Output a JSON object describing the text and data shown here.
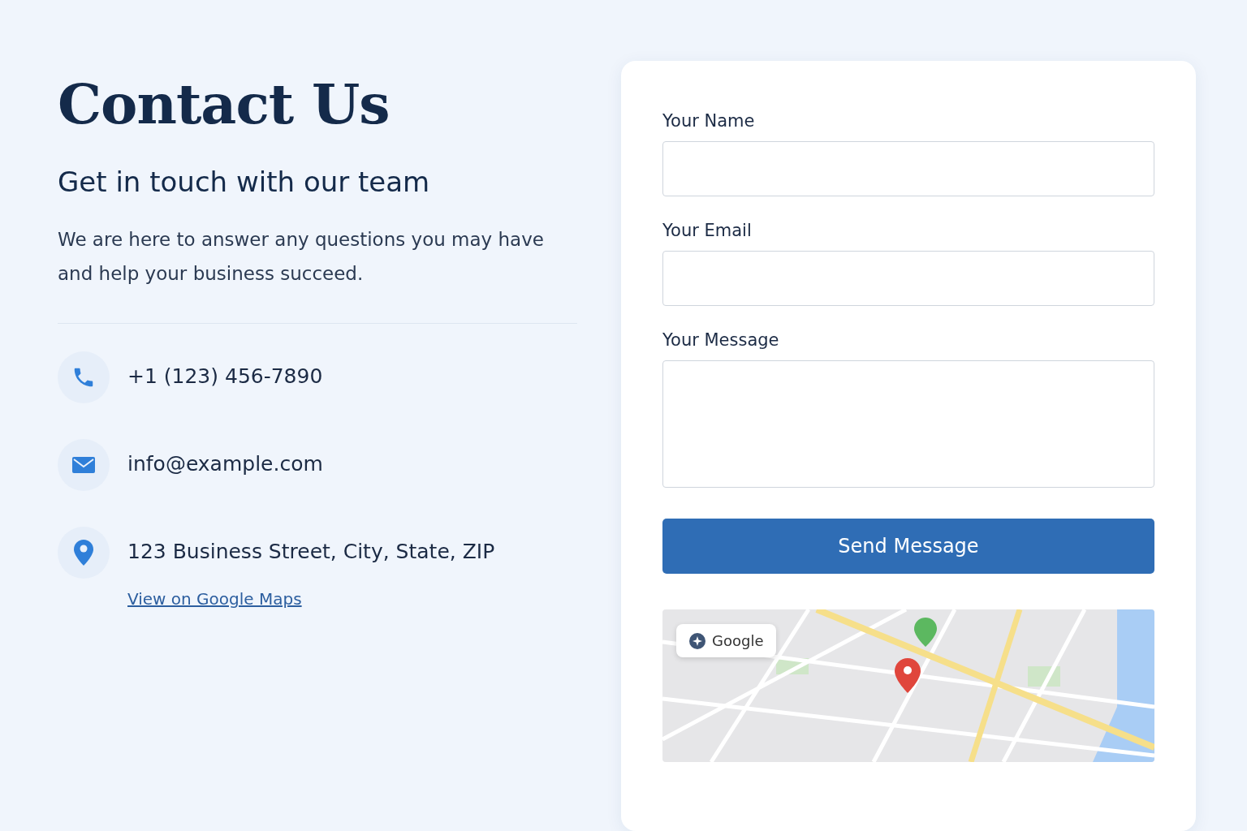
{
  "heading": "Contact Us",
  "subheading": "Get in touch with our team",
  "intro": "We are here to answer any questions you may have and help your business succeed.",
  "contacts": [
    {
      "kind": "phone",
      "text": "+1 (123) 456-7890"
    },
    {
      "kind": "email",
      "text": "info@example.com"
    },
    {
      "kind": "location",
      "text": "123 Business Street, City, State, ZIP",
      "link": "View on Google Maps"
    }
  ],
  "form": {
    "fields": [
      {
        "kind": "input",
        "label": "Your Name"
      },
      {
        "kind": "input",
        "label": "Your Email"
      },
      {
        "kind": "textarea",
        "label": "Your Message"
      }
    ],
    "submit": "Send Message"
  },
  "map": {
    "kind": "picture",
    "chip": "Google"
  }
}
